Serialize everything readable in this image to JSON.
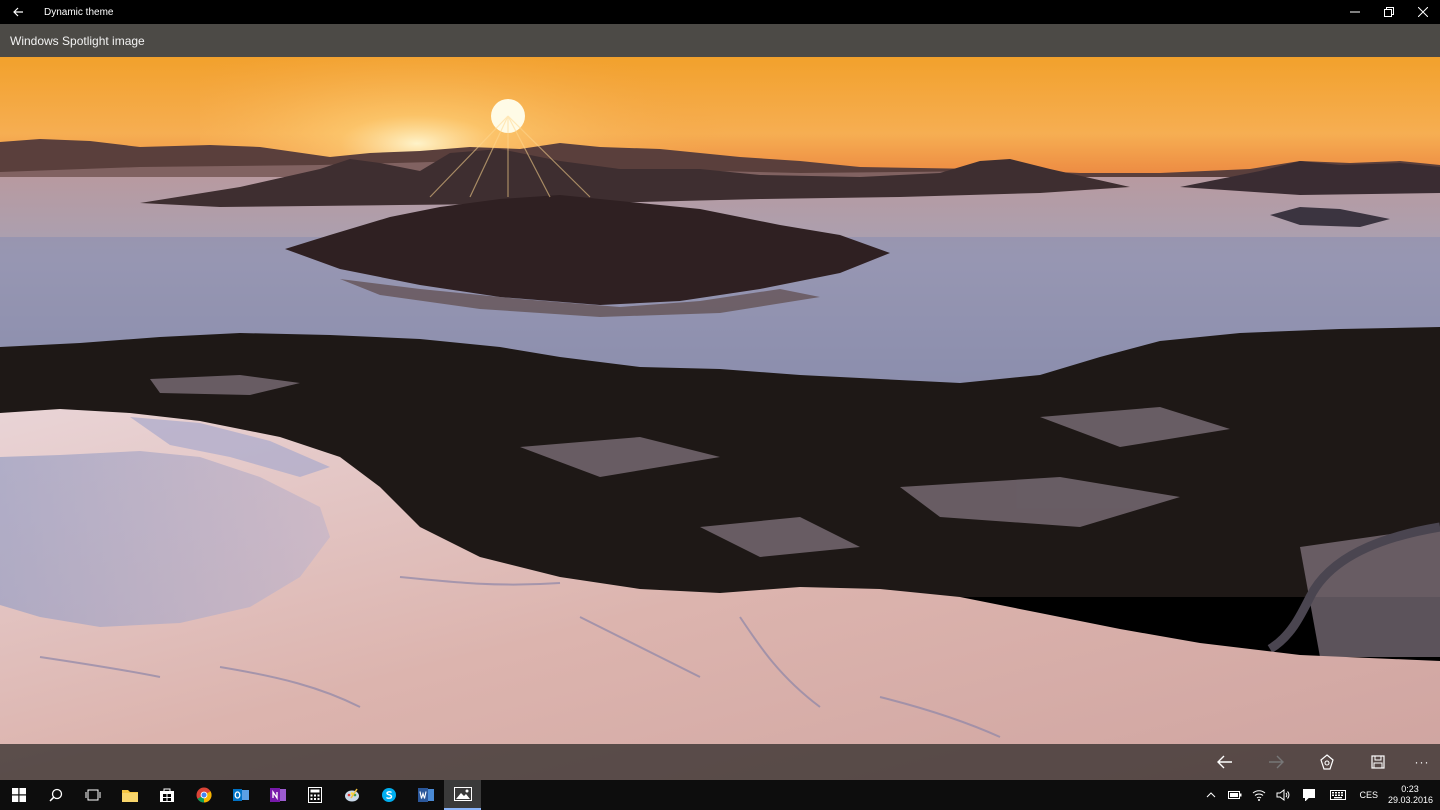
{
  "window": {
    "title": "Dynamic theme",
    "back_icon": "back-arrow-icon",
    "controls": [
      "minimize-icon",
      "maximize-icon",
      "close-icon"
    ]
  },
  "subheader": {
    "title": "Windows Spotlight image"
  },
  "photo": {
    "kind": "landscape-photo",
    "colors": {
      "sky_top": "#f0a030",
      "sun": "#fff6c8",
      "water": "#8f90a8",
      "snow": "#d9b7b4",
      "forest": "#1c1614"
    }
  },
  "command_bar": {
    "buttons": [
      "back-arrow-icon",
      "forward-arrow-icon",
      "set-as-icon",
      "save-icon",
      "more-icon"
    ],
    "more_label": "···"
  },
  "taskbar": {
    "apps": [
      "start",
      "search",
      "task-view",
      "file-explorer",
      "store",
      "chrome",
      "outlook",
      "onenote",
      "calculator",
      "paint",
      "skype",
      "word",
      "photos"
    ],
    "active_app": "photos",
    "tray": {
      "icons": [
        "chevron-up-icon",
        "battery-icon",
        "wifi-icon",
        "volume-icon",
        "action-center-icon",
        "keyboard-icon"
      ],
      "language": "CES",
      "time": "0:23",
      "date": "29.03.2016"
    }
  }
}
